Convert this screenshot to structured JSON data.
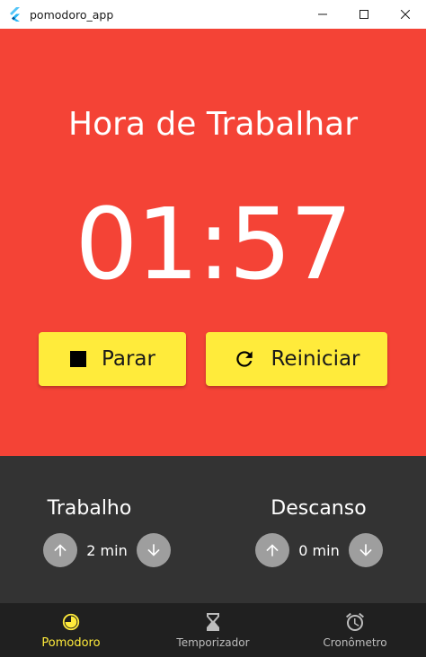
{
  "window": {
    "title": "pomodoro_app"
  },
  "timer": {
    "status_title": "Hora de Trabalhar",
    "time_display": "01:57",
    "stop_label": "Parar",
    "restart_label": "Reiniciar"
  },
  "settings": {
    "work": {
      "label": "Trabalho",
      "value": "2 min"
    },
    "rest": {
      "label": "Descanso",
      "value": "0 min"
    }
  },
  "nav": {
    "items": [
      {
        "label": "Pomodoro",
        "icon": "pomodoro-icon",
        "active": true
      },
      {
        "label": "Temporizador",
        "icon": "hourglass-icon",
        "active": false
      },
      {
        "label": "Cronômetro",
        "icon": "alarm-clock-icon",
        "active": false
      }
    ]
  },
  "colors": {
    "work_background": "#F44336",
    "button_yellow": "#FFEB3B",
    "settings_background": "#333333",
    "nav_background": "#202020",
    "nav_active": "#FFEB3B",
    "nav_inactive": "#BDBDBD",
    "stepper_button": "#9E9E9E"
  }
}
